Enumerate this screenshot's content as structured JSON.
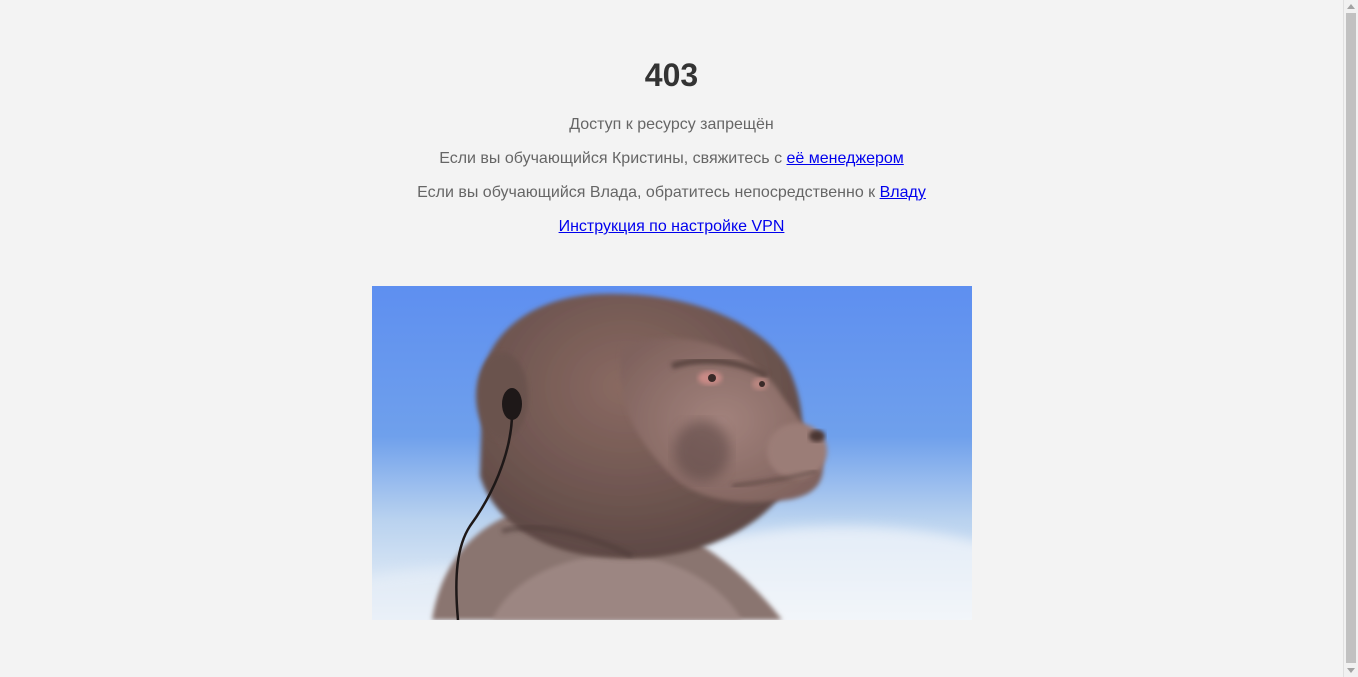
{
  "error": {
    "code": "403",
    "message": "Доступ к ресурсу запрещён"
  },
  "line_kristina": {
    "text": "Если вы обучающийся Кристины, свяжитесь с ",
    "link": "её менеджером"
  },
  "line_vlad": {
    "text": "Если вы обучающийся Влада, обратитесь непосредственно к ",
    "link": "Владу"
  },
  "vpn_link": "Инструкция по настройке VPN",
  "image": {
    "subject": "monkey-with-earphones-gif"
  }
}
